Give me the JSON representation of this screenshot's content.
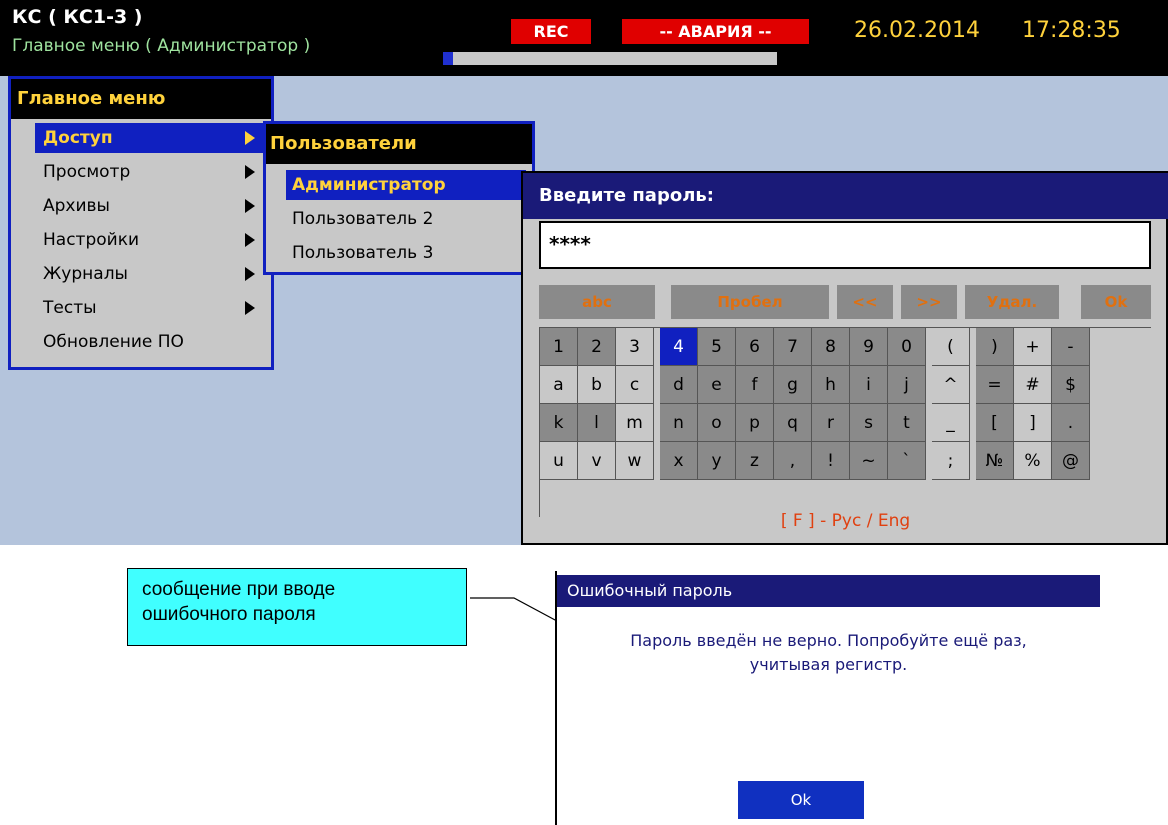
{
  "header": {
    "device_title": "КС ( КС1-3 )",
    "subtitle": "Главное меню ( Администратор )",
    "rec_label": "REC",
    "alarm_label": "-- АВАРИЯ --",
    "date": "26.02.2014",
    "time": "17:28:35",
    "progress": 0.03
  },
  "main_menu": {
    "title": "Главное меню",
    "items": [
      {
        "label": "Доступ",
        "has_submenu": true,
        "selected": true
      },
      {
        "label": "Просмотр",
        "has_submenu": true
      },
      {
        "label": "Архивы",
        "has_submenu": true
      },
      {
        "label": "Настройки",
        "has_submenu": true
      },
      {
        "label": "Журналы",
        "has_submenu": true
      },
      {
        "label": "Тесты",
        "has_submenu": true
      },
      {
        "label": "Обновление ПО",
        "has_submenu": false
      }
    ]
  },
  "users_menu": {
    "title": "Пользователи",
    "items": [
      {
        "label": "Администратор",
        "selected": true
      },
      {
        "label": "Пользователь 2"
      },
      {
        "label": "Пользователь 3"
      }
    ]
  },
  "password_dialog": {
    "title": "Введите пароль:",
    "value": "****",
    "function_keys": {
      "abc": "abc",
      "space": "Пробел",
      "left": "<<",
      "right": ">>",
      "delete": "Удал.",
      "ok": "Ok"
    },
    "keyboard_rows": [
      [
        "1",
        "2",
        "3",
        "4",
        "5",
        "6",
        "7",
        "8",
        "9",
        "0",
        "(",
        ")",
        "+",
        "-"
      ],
      [
        "a",
        "b",
        "c",
        "d",
        "e",
        "f",
        "g",
        "h",
        "i",
        "j",
        "^",
        "=",
        "#",
        "$"
      ],
      [
        "k",
        "l",
        "m",
        "n",
        "o",
        "p",
        "q",
        "r",
        "s",
        "t",
        "_",
        "[",
        "]",
        "."
      ],
      [
        "u",
        "v",
        "w",
        "x",
        "y",
        "z",
        ",",
        "!",
        "~",
        "`",
        ";",
        "№",
        "%",
        "@"
      ]
    ],
    "selected_key": "4",
    "lang_hint": "[ F ] - Рус / Eng"
  },
  "callout": {
    "line1": "сообщение при вводе",
    "line2": "ошибочного пароля"
  },
  "error_dialog": {
    "title": "Ошибочный пароль",
    "line1": "Пароль введён не верно. Попробуйте ещё раз,",
    "line2": "учитывая регистр.",
    "ok_label": "Ok"
  },
  "colors": {
    "screen_bg": "#b4c4dc",
    "accent_blue": "#1020c0",
    "title_navy": "#1a1a78",
    "highlight_yellow": "#ffd23c",
    "alarm_red": "#e00000",
    "fkey_orange": "#e07010",
    "callout_cyan": "#40ffff"
  }
}
